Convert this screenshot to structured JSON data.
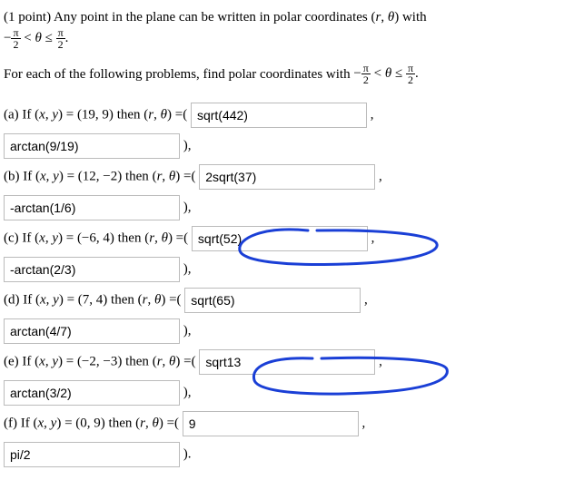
{
  "header": {
    "points_label": "(1 point)",
    "intro": "Any point in the plane can be written in polar coordinates",
    "coord_expr": "(r, θ)",
    "with": "with",
    "range_prefix": "−",
    "range_mid": " < θ ≤ ",
    "instruction": "For each of the following problems, find polar coordinates with "
  },
  "frac": {
    "num": "π",
    "den": "2"
  },
  "parts": {
    "a": {
      "label": "(a) If ",
      "xy": "(x, y) = (19, 9)",
      "then": " then ",
      "rt": "(r, θ) =",
      "r_val": "sqrt(442)",
      "th_val": "arctan(9/19)"
    },
    "b": {
      "label": "(b) If ",
      "xy": "(x, y) = (12, −2)",
      "then": " then ",
      "rt": "(r, θ) =",
      "r_val": "2sqrt(37)",
      "th_val": "-arctan(1/6)"
    },
    "c": {
      "label": "(c) If ",
      "xy": "(x, y) = (−6, 4)",
      "then": " then ",
      "rt": "(r, θ) =",
      "r_val": "sqrt(52)",
      "th_val": "-arctan(2/3)"
    },
    "d": {
      "label": "(d) If ",
      "xy": "(x, y) = (7, 4)",
      "then": " then ",
      "rt": "(r, θ) =",
      "r_val": "sqrt(65)",
      "th_val": "arctan(4/7)"
    },
    "e": {
      "label": "(e) If ",
      "xy": "(x, y) = (−2, −3)",
      "then": " then ",
      "rt": "(r, θ) =",
      "r_val": "sqrt13",
      "th_val": "arctan(3/2)"
    },
    "f": {
      "label": "(f) If ",
      "xy": "(x, y) = (0, 9)",
      "then": " then ",
      "rt": "(r, θ) =",
      "r_val": "9",
      "th_val": "pi/2"
    }
  },
  "punct": {
    "comma": ",",
    "close_comma": "),",
    "close_period": ").",
    "open": "("
  }
}
